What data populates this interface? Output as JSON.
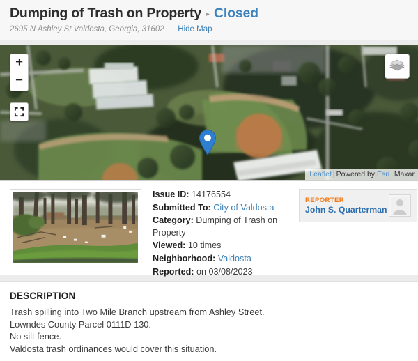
{
  "header": {
    "title": "Dumping of Trash on Property",
    "separator": "▸",
    "status": "Closed",
    "address": "2695 N Ashley St Valdosta, Georgia, 31602",
    "dot": "·",
    "hide_map_label": "Hide Map"
  },
  "map": {
    "zoom_in_label": "+",
    "zoom_out_label": "−",
    "fullscreen_icon": "fullscreen-icon",
    "layers_icon": "layers-icon",
    "marker_icon": "map-marker-icon",
    "attribution": {
      "leaflet": "Leaflet",
      "bar1": "|",
      "powered_by": "Powered by",
      "esri": "Esri",
      "bar2": "|",
      "maxar": "Maxar"
    }
  },
  "details": {
    "photo_alt": "issue-photo-thumbnail",
    "fields": [
      {
        "label": "Issue ID:",
        "value": "14176554",
        "link": false
      },
      {
        "label": "Submitted To:",
        "value": "City of Valdosta",
        "link": true
      },
      {
        "label": "Category:",
        "value": "Dumping of Trash on Property",
        "link": false
      },
      {
        "label": "Viewed:",
        "value": "10 times",
        "link": false
      },
      {
        "label": "Neighborhood:",
        "value": "Valdosta",
        "link": true
      },
      {
        "label": "Reported:",
        "value": "on 03/08/2023",
        "link": false
      }
    ],
    "reporter": {
      "label": "REPORTER",
      "name": "John S. Quarterman",
      "avatar_icon": "user-avatar-placeholder-icon"
    }
  },
  "description": {
    "heading": "DESCRIPTION",
    "lines": [
      "Trash spilling into Two Mile Branch upstream from Ashley Street.",
      "Lowndes County Parcel 0111D 130.",
      "No silt fence.",
      "Valdosta trash ordinances would cover this situation."
    ]
  },
  "colors": {
    "link_blue": "#3b7fb5",
    "status_blue": "#3b83c0",
    "reporter_orange": "#ef7a17",
    "page_bg": "#ececec",
    "header_bg": "#f7f7f7"
  }
}
